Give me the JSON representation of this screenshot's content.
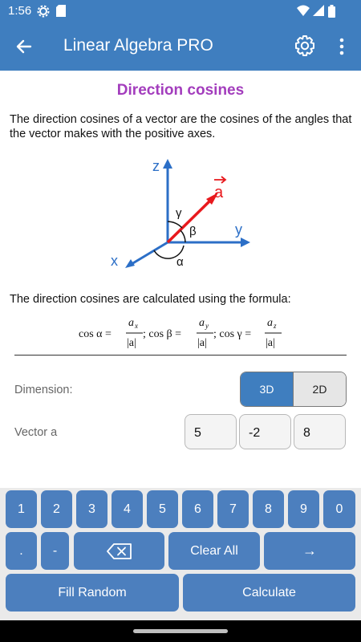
{
  "status": {
    "time": "1:56"
  },
  "app": {
    "title": "Linear Algebra PRO"
  },
  "page": {
    "heading": "Direction cosines",
    "intro": "The direction cosines of a vector are the cosines of the angles that the vector makes with the positive axes.",
    "formula_intro": "The direction cosines are calculated using the formula:",
    "diagram": {
      "axis_z": "z",
      "axis_y": "y",
      "axis_x": "x",
      "vector": "a",
      "gamma": "γ",
      "beta": "β",
      "alpha": "α"
    },
    "formula": {
      "cos_alpha": "cos α =",
      "a_x": "a",
      "sub_x": "x",
      "denom": "|a|",
      "cos_beta": "; cos β =",
      "a_y": "a",
      "sub_y": "y",
      "cos_gamma": "; cos γ =",
      "a_z": "a",
      "sub_z": "z"
    }
  },
  "form": {
    "dimension_label": "Dimension:",
    "dim_3d": "3D",
    "dim_2d": "2D",
    "dimension_selected": "3D",
    "vector_label": "Vector a",
    "vector_values": [
      "5",
      "-2",
      "8"
    ]
  },
  "keyboard": {
    "digits": [
      "1",
      "2",
      "3",
      "4",
      "5",
      "6",
      "7",
      "8",
      "9",
      "0"
    ],
    "dot": ".",
    "minus": "-",
    "clear_all": "Clear All",
    "next": "→",
    "fill_random": "Fill Random",
    "calculate": "Calculate"
  },
  "colors": {
    "primary": "#3f7ebf",
    "key": "#4c7fbe",
    "heading": "#a33dbd",
    "vector": "#e8191d",
    "axis": "#2c6fc7"
  }
}
